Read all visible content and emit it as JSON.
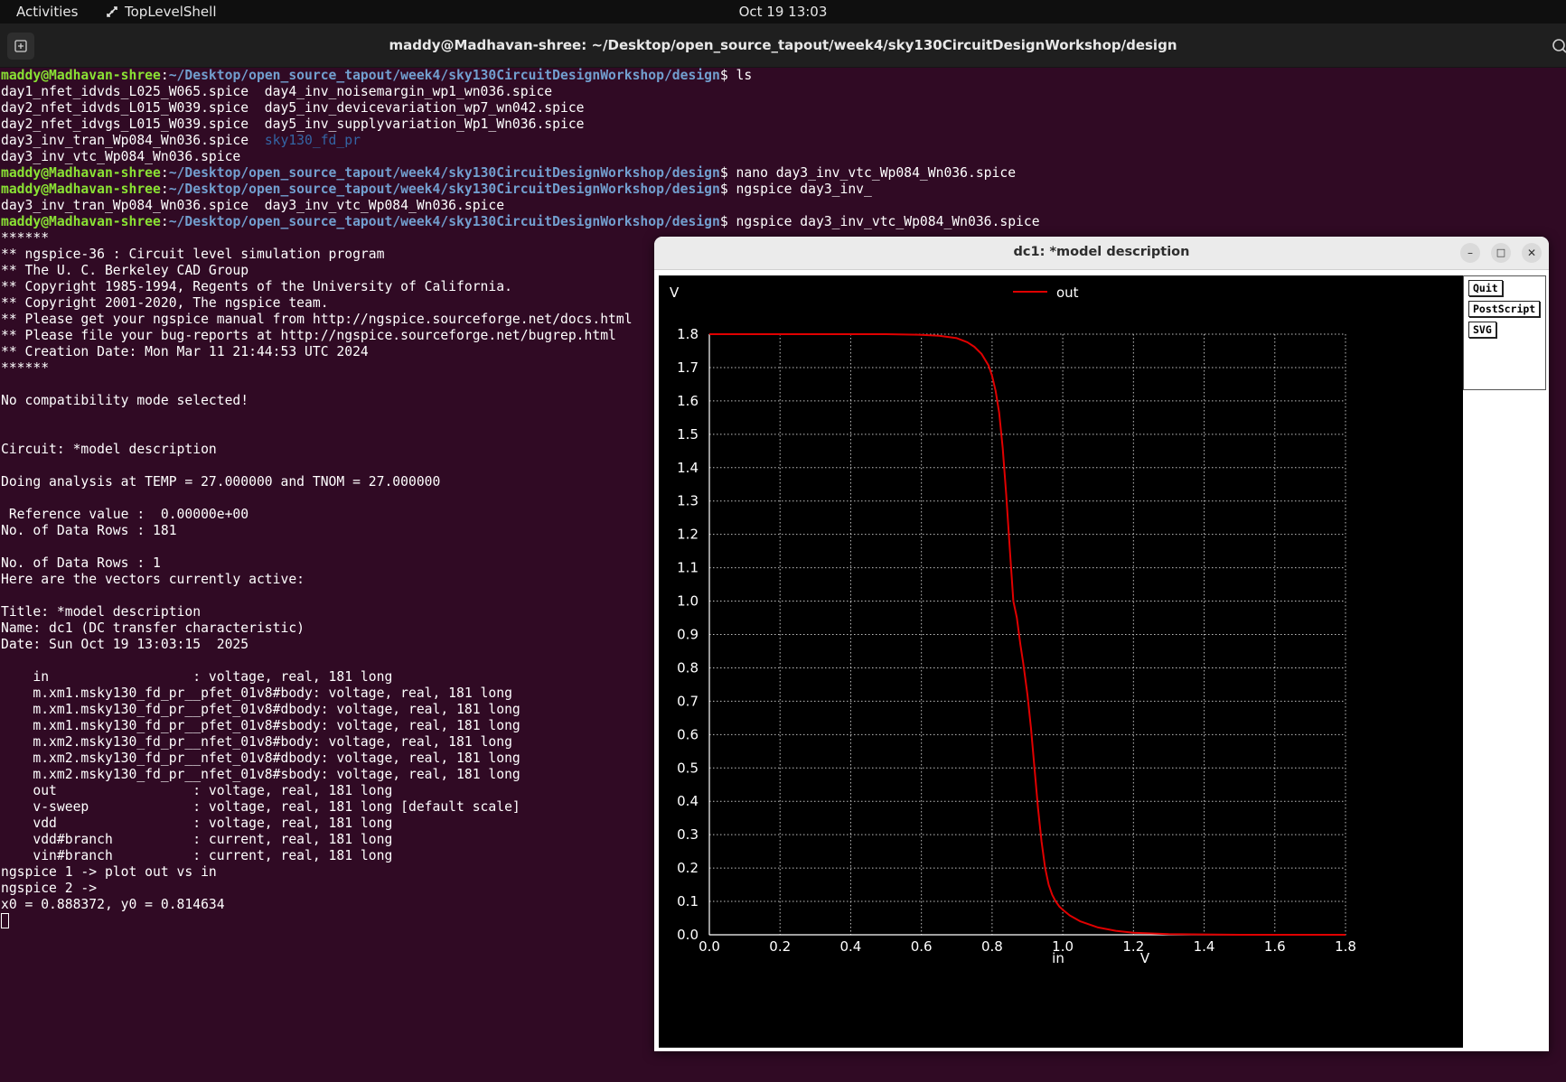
{
  "topbar": {
    "activities": "Activities",
    "app_name": "TopLevelShell",
    "clock": "Oct 19  13:03"
  },
  "terminal": {
    "title": "maddy@Madhavan-shree: ~/Desktop/open_source_tapout/week4/sky130CircuitDesignWorkshop/design",
    "prompt_user": "maddy@Madhavan-shree",
    "prompt_path": "~/Desktop/open_source_tapout/week4/sky130CircuitDesignWorkshop/design",
    "lines": [
      {
        "prompt": true,
        "cmd": "ls"
      },
      {
        "text": "day1_nfet_idvds_L025_W065.spice  day4_inv_noisemargin_wp1_wn036.spice"
      },
      {
        "text": "day2_nfet_idvds_L015_W039.spice  day5_inv_devicevariation_wp7_wn042.spice"
      },
      {
        "text": "day2_nfet_idvgs_L015_W039.spice  day5_inv_supplyvariation_Wp1_Wn036.spice"
      },
      {
        "text": "day3_inv_tran_Wp084_Wn036.spice  ",
        "blue": "sky130_fd_pr"
      },
      {
        "text": "day3_inv_vtc_Wp084_Wn036.spice"
      },
      {
        "prompt": true,
        "cmd": "nano day3_inv_vtc_Wp084_Wn036.spice"
      },
      {
        "prompt": true,
        "cmd": "ngspice day3_inv_"
      },
      {
        "text": "day3_inv_tran_Wp084_Wn036.spice  day3_inv_vtc_Wp084_Wn036.spice"
      },
      {
        "prompt": true,
        "cmd": "ngspice day3_inv_vtc_Wp084_Wn036.spice"
      },
      {
        "text": "******"
      },
      {
        "text": "** ngspice-36 : Circuit level simulation program"
      },
      {
        "text": "** The U. C. Berkeley CAD Group"
      },
      {
        "text": "** Copyright 1985-1994, Regents of the University of California."
      },
      {
        "text": "** Copyright 2001-2020, The ngspice team."
      },
      {
        "text": "** Please get your ngspice manual from http://ngspice.sourceforge.net/docs.html"
      },
      {
        "text": "** Please file your bug-reports at http://ngspice.sourceforge.net/bugrep.html"
      },
      {
        "text": "** Creation Date: Mon Mar 11 21:44:53 UTC 2024"
      },
      {
        "text": "******"
      },
      {
        "text": ""
      },
      {
        "text": "No compatibility mode selected!"
      },
      {
        "text": ""
      },
      {
        "text": ""
      },
      {
        "text": "Circuit: *model description"
      },
      {
        "text": ""
      },
      {
        "text": "Doing analysis at TEMP = 27.000000 and TNOM = 27.000000"
      },
      {
        "text": ""
      },
      {
        "text": " Reference value :  0.00000e+00"
      },
      {
        "text": "No. of Data Rows : 181"
      },
      {
        "text": ""
      },
      {
        "text": "No. of Data Rows : 1"
      },
      {
        "text": "Here are the vectors currently active:"
      },
      {
        "text": ""
      },
      {
        "text": "Title: *model description"
      },
      {
        "text": "Name: dc1 (DC transfer characteristic)"
      },
      {
        "text": "Date: Sun Oct 19 13:03:15  2025"
      },
      {
        "text": ""
      },
      {
        "text": "    in                  : voltage, real, 181 long"
      },
      {
        "text": "    m.xm1.msky130_fd_pr__pfet_01v8#body: voltage, real, 181 long"
      },
      {
        "text": "    m.xm1.msky130_fd_pr__pfet_01v8#dbody: voltage, real, 181 long"
      },
      {
        "text": "    m.xm1.msky130_fd_pr__pfet_01v8#sbody: voltage, real, 181 long"
      },
      {
        "text": "    m.xm2.msky130_fd_pr__nfet_01v8#body: voltage, real, 181 long"
      },
      {
        "text": "    m.xm2.msky130_fd_pr__nfet_01v8#dbody: voltage, real, 181 long"
      },
      {
        "text": "    m.xm2.msky130_fd_pr__nfet_01v8#sbody: voltage, real, 181 long"
      },
      {
        "text": "    out                 : voltage, real, 181 long"
      },
      {
        "text": "    v-sweep             : voltage, real, 181 long [default scale]"
      },
      {
        "text": "    vdd                 : voltage, real, 181 long"
      },
      {
        "text": "    vdd#branch          : current, real, 181 long"
      },
      {
        "text": "    vin#branch          : current, real, 181 long"
      },
      {
        "text": "ngspice 1 -> plot out vs in"
      },
      {
        "text": "ngspice 2 ->"
      },
      {
        "text": "x0 = 0.888372, y0 = 0.814634"
      },
      {
        "cursor": true
      }
    ]
  },
  "plot_window": {
    "title": "dc1: *model description",
    "buttons": {
      "minimize": "–",
      "maximize": "□",
      "close": "✕"
    },
    "side_buttons": {
      "quit": "Quit",
      "postscript": "PostScript",
      "svg": "SVG"
    }
  },
  "chart_data": {
    "type": "line",
    "ylabel": "V",
    "xlabel": "in",
    "xunit": "V",
    "xlim": [
      0.0,
      1.8
    ],
    "ylim": [
      0.0,
      1.8
    ],
    "x_ticks": [
      "0.0",
      "0.2",
      "0.4",
      "0.6",
      "0.8",
      "1.0",
      "1.2",
      "1.4",
      "1.6",
      "1.8"
    ],
    "y_ticks": [
      "0.0",
      "0.1",
      "0.2",
      "0.3",
      "0.4",
      "0.5",
      "0.6",
      "0.7",
      "0.8",
      "0.9",
      "1.0",
      "1.1",
      "1.2",
      "1.3",
      "1.4",
      "1.5",
      "1.6",
      "1.7",
      "1.8"
    ],
    "grid": true,
    "legend_position": "top",
    "background": "#000000",
    "grid_color": "#bfbfbf",
    "text_color": "#ffffff",
    "series": [
      {
        "name": "out",
        "color": "#e00000",
        "x": [
          0.0,
          0.3,
          0.5,
          0.6,
          0.65,
          0.7,
          0.73,
          0.75,
          0.77,
          0.79,
          0.8,
          0.81,
          0.82,
          0.83,
          0.84,
          0.85,
          0.86,
          0.87,
          0.88,
          0.888,
          0.9,
          0.91,
          0.92,
          0.93,
          0.94,
          0.95,
          0.96,
          0.97,
          0.98,
          0.99,
          1.0,
          1.02,
          1.05,
          1.1,
          1.15,
          1.2,
          1.25,
          1.3,
          1.4,
          1.5,
          1.8
        ],
        "y": [
          1.8,
          1.8,
          1.8,
          1.798,
          1.795,
          1.788,
          1.776,
          1.762,
          1.741,
          1.706,
          1.675,
          1.63,
          1.565,
          1.46,
          1.32,
          1.16,
          1.0,
          0.95,
          0.87,
          0.815,
          0.72,
          0.62,
          0.5,
          0.38,
          0.28,
          0.2,
          0.15,
          0.12,
          0.1,
          0.085,
          0.075,
          0.058,
          0.04,
          0.022,
          0.012,
          0.006,
          0.004,
          0.002,
          0.001,
          0.0,
          0.0
        ]
      }
    ]
  }
}
